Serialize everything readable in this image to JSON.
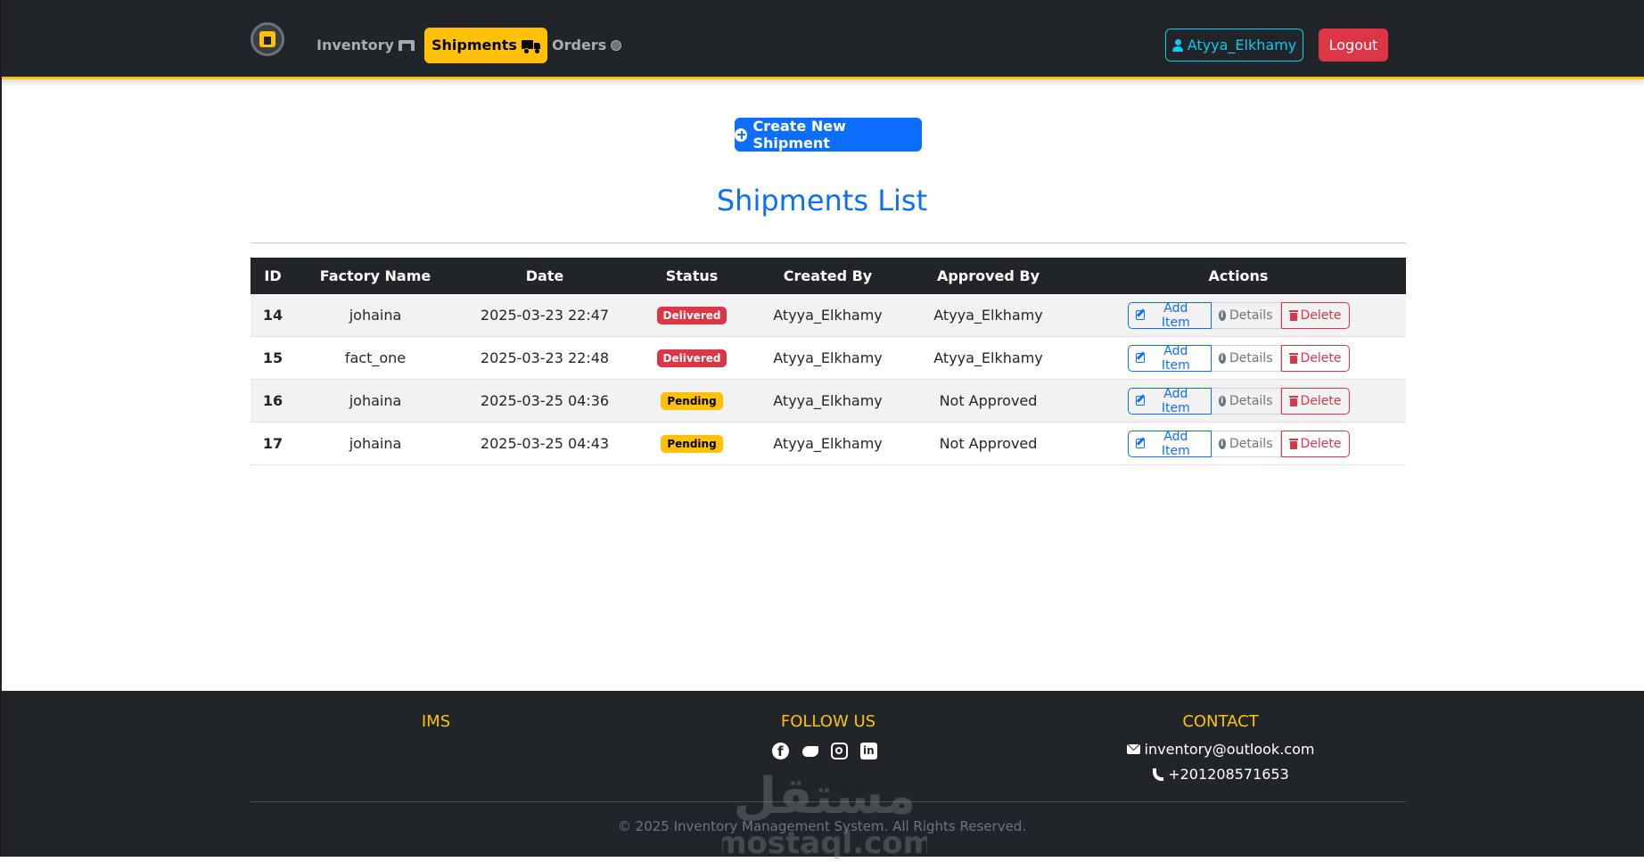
{
  "nav": {
    "links": [
      {
        "label": "Inventory",
        "icon": "warehouse-icon"
      },
      {
        "label": "Shipments",
        "icon": "truck-icon",
        "active": true
      },
      {
        "label": "Orders",
        "icon": "circle-icon"
      }
    ],
    "user_label": "Atyya_Elkhamy",
    "logout_label": "Logout"
  },
  "main": {
    "create_button_label": "Create New Shipment",
    "title": "Shipments List",
    "table": {
      "headers": [
        "ID",
        "Factory Name",
        "Date",
        "Status",
        "Created By",
        "Approved By",
        "Actions"
      ],
      "rows": [
        {
          "id": "14",
          "factory": "johaina",
          "date": "2025-03-23 22:47",
          "status": "Delivered",
          "created_by": "Atyya_Elkhamy",
          "approved_by": "Atyya_Elkhamy"
        },
        {
          "id": "15",
          "factory": "fact_one",
          "date": "2025-03-23 22:48",
          "status": "Delivered",
          "created_by": "Atyya_Elkhamy",
          "approved_by": "Atyya_Elkhamy"
        },
        {
          "id": "16",
          "factory": "johaina",
          "date": "2025-03-25 04:36",
          "status": "Pending",
          "created_by": "Atyya_Elkhamy",
          "approved_by": "Not Approved"
        },
        {
          "id": "17",
          "factory": "johaina",
          "date": "2025-03-25 04:43",
          "status": "Pending",
          "created_by": "Atyya_Elkhamy",
          "approved_by": "Not Approved"
        }
      ],
      "actions": {
        "add_item": "Add Item",
        "details": "Details",
        "delete": "Delete"
      }
    }
  },
  "footer": {
    "ims_heading": "IMS",
    "follow_heading": "FOLLOW US",
    "contact_heading": "CONTACT",
    "social": [
      "facebook-icon",
      "twitter-icon",
      "instagram-icon",
      "linkedin-icon"
    ],
    "email": "inventory@outlook.com",
    "phone": "+201208571653",
    "copyright": "© 2025 Inventory Management System. All Rights Reserved.",
    "watermark_text": "mostaql.com",
    "watermark_arabic": "مستقل"
  },
  "colors": {
    "navbar_bg": "#212529",
    "accent": "#ffc107",
    "primary": "#0d6efd",
    "danger": "#dc3545",
    "info": "#0dcaf0"
  }
}
